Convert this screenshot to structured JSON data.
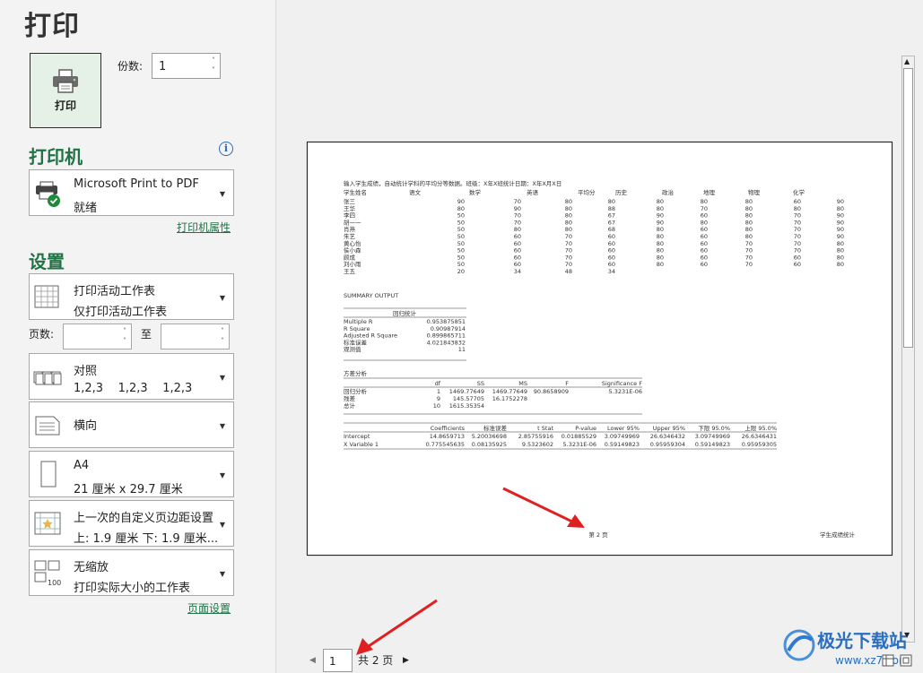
{
  "title": "打印",
  "print_button": "打印",
  "copies": {
    "label": "份数:",
    "value": "1"
  },
  "printer": {
    "heading": "打印机",
    "name": "Microsoft Print to PDF",
    "status": "就绪",
    "properties_link": "打印机属性"
  },
  "settings": {
    "heading": "设置",
    "scope": {
      "line1": "打印活动工作表",
      "line2": "仅打印活动工作表"
    },
    "pages_label": "页数:",
    "pages_to": "至",
    "collate": {
      "line1": "对照",
      "line2": "1,2,3    1,2,3    1,2,3"
    },
    "orientation": {
      "line1": "横向"
    },
    "paper": {
      "line1": "A4",
      "line2": "21 厘米 x 29.7 厘米"
    },
    "margins": {
      "line1": "上一次的自定义页边距设置",
      "line2": "上: 1.9 厘米 下: 1.9 厘米..."
    },
    "scaling": {
      "line1": "无缩放",
      "line2": "打印实际大小的工作表"
    },
    "page_setup_link": "页面设置"
  },
  "preview": {
    "header_line": "输入学生成绩，自动统计学科的平均分等数据。班级：X年X班统计日期：X年X月X日",
    "columns": [
      "学生姓名",
      "语文",
      "数学",
      "英语",
      "平均分",
      "历史",
      "政治",
      "地理",
      "物理",
      "化学"
    ],
    "rows": [
      [
        "张三",
        "90",
        "70",
        "80",
        "80",
        "80",
        "80",
        "80",
        "60",
        "90"
      ],
      [
        "王华",
        "80",
        "90",
        "80",
        "88",
        "80",
        "70",
        "80",
        "80",
        "80"
      ],
      [
        "李四",
        "50",
        "70",
        "80",
        "67",
        "90",
        "60",
        "80",
        "70",
        "90"
      ],
      [
        "胡一一",
        "50",
        "70",
        "80",
        "67",
        "90",
        "80",
        "80",
        "70",
        "90"
      ],
      [
        "肖燕",
        "50",
        "80",
        "80",
        "68",
        "80",
        "60",
        "80",
        "70",
        "90"
      ],
      [
        "朱艺",
        "50",
        "60",
        "70",
        "60",
        "80",
        "60",
        "80",
        "70",
        "90"
      ],
      [
        "黄心怡",
        "50",
        "60",
        "70",
        "60",
        "80",
        "60",
        "70",
        "70",
        "80"
      ],
      [
        "侯小森",
        "50",
        "60",
        "70",
        "60",
        "80",
        "60",
        "70",
        "70",
        "80"
      ],
      [
        "顾成",
        "50",
        "60",
        "70",
        "60",
        "80",
        "60",
        "70",
        "60",
        "80"
      ],
      [
        "刘小雨",
        "50",
        "60",
        "70",
        "60",
        "80",
        "60",
        "70",
        "60",
        "80"
      ],
      [
        "王五",
        "20",
        "34",
        "48",
        "34",
        "",
        "",
        "",
        "",
        ""
      ]
    ],
    "summary_title": "SUMMARY OUTPUT",
    "regression_title": "回归统计",
    "regression": [
      [
        "Multiple R",
        "0.953875851"
      ],
      [
        "R Square",
        "0.90987914"
      ],
      [
        "Adjusted R Square",
        "0.899865711"
      ],
      [
        "标准误差",
        "4.021843832"
      ],
      [
        "观测值",
        "11"
      ]
    ],
    "anova_title": "方差分析",
    "anova_header": [
      "",
      "df",
      "SS",
      "MS",
      "F",
      "Significance F"
    ],
    "anova": [
      [
        "回归分析",
        "1",
        "1469.77649",
        "1469.77649",
        "90.8658909",
        "5.3231E-06"
      ],
      [
        "残差",
        "9",
        "145.57705",
        "16.1752278",
        "",
        ""
      ],
      [
        "总计",
        "10",
        "1615.35354",
        "",
        "",
        ""
      ]
    ],
    "coef_header": [
      "",
      "Coefficients",
      "标准误差",
      "t Stat",
      "P-value",
      "Lower 95%",
      "Upper 95%",
      "下限 95.0%",
      "上限 95.0%"
    ],
    "coef": [
      [
        "Intercept",
        "14.8659713",
        "5.20036698",
        "2.85755916",
        "0.01885529",
        "3.09749969",
        "26.6346432",
        "3.09749969",
        "26.6346431"
      ],
      [
        "X Variable 1",
        "0.775545635",
        "0.08135925",
        "9.5323602",
        "5.3231E-06",
        "0.59149823",
        "0.95959304",
        "0.59149823",
        "0.95959305"
      ]
    ],
    "footer_center": "第 2 页",
    "footer_right": "学生成绩统计"
  },
  "nav": {
    "current_page": "1",
    "total": "共 2 页"
  },
  "watermark": {
    "text": "极光下载站",
    "url": "www.xz7.com"
  }
}
